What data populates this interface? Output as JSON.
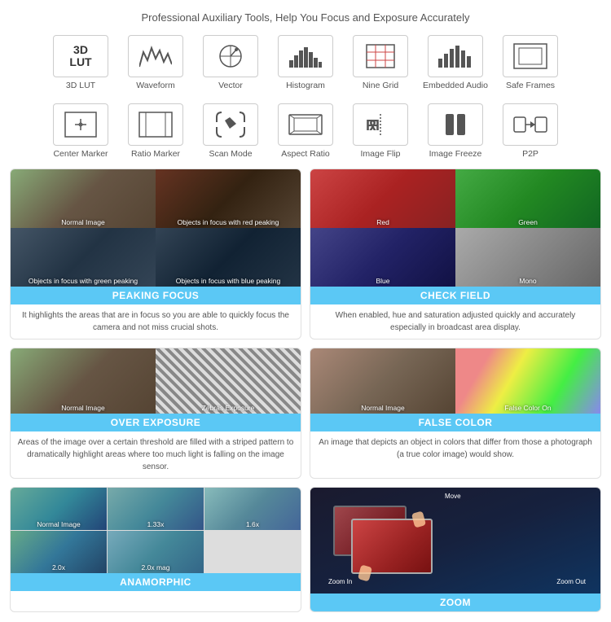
{
  "header": {
    "title": "Professional Auxiliary Tools, Help You Focus and Exposure Accurately"
  },
  "tools": {
    "row1": [
      {
        "id": "3d-lut",
        "label": "3D LUT",
        "icon_type": "lut"
      },
      {
        "id": "waveform",
        "label": "Waveform",
        "icon_type": "waveform"
      },
      {
        "id": "vector",
        "label": "Vector",
        "icon_type": "vector"
      },
      {
        "id": "histogram",
        "label": "Histogram",
        "icon_type": "histogram"
      },
      {
        "id": "nine-grid",
        "label": "Nine Grid",
        "icon_type": "ninegrid"
      },
      {
        "id": "embedded-audio",
        "label": "Embedded Audio",
        "icon_type": "audio"
      },
      {
        "id": "safe-frames",
        "label": "Safe Frames",
        "icon_type": "safeframes"
      }
    ],
    "row2": [
      {
        "id": "center-marker",
        "label": "Center Marker",
        "icon_type": "centermarker"
      },
      {
        "id": "ratio-marker",
        "label": "Ratio Marker",
        "icon_type": "ratiomarker"
      },
      {
        "id": "scan-mode",
        "label": "Scan Mode",
        "icon_type": "scanmode"
      },
      {
        "id": "aspect-ratio",
        "label": "Aspect Ratio",
        "icon_type": "aspectratio"
      },
      {
        "id": "image-flip",
        "label": "Image Flip",
        "icon_type": "imageflip"
      },
      {
        "id": "image-freeze",
        "label": "Image Freeze",
        "icon_type": "imagefreeze"
      },
      {
        "id": "p2p",
        "label": "P2P",
        "icon_type": "p2p"
      }
    ]
  },
  "features": [
    {
      "id": "peaking-focus",
      "title": "PEAKING FOCUS",
      "description": "It highlights the areas that are in focus so you are able to quickly focus the camera and not miss crucial shots.",
      "images": [
        {
          "label": "Normal Image",
          "class": "img-horse-normal"
        },
        {
          "label": "Objects in focus with red peaking",
          "class": "img-horse-red"
        },
        {
          "label": "Objects in focus with green peaking",
          "class": "img-horse-green-peak"
        },
        {
          "label": "Objects in focus with blue peaking",
          "class": "img-horse-blue-peak"
        }
      ]
    },
    {
      "id": "check-field",
      "title": "CHECK FIELD",
      "description": "When enabled, hue and saturation adjusted quickly and accurately especially in broadcast area display.",
      "images": [
        {
          "label": "Red",
          "class": "img-check-red"
        },
        {
          "label": "Green",
          "class": "img-check-green"
        },
        {
          "label": "Blue",
          "class": "img-check-blue"
        },
        {
          "label": "Mono",
          "class": "img-check-mono"
        }
      ]
    },
    {
      "id": "over-exposure",
      "title": "OVER EXPOSURE",
      "description": "Areas of the image over a certain threshold are filled with a striped pattern to dramatically highlight areas where too much light is falling on the image sensor.",
      "images": [
        {
          "label": "Normal Image",
          "class": "img-horse-normal"
        },
        {
          "label": "Zebras Exposure",
          "class": "img-horse-zebra"
        }
      ]
    },
    {
      "id": "false-color",
      "title": "FALSE COLOR",
      "description": "An image that depicts an object in colors that differ from those a photograph (a true color image) would show.",
      "images": [
        {
          "label": "Normal Image",
          "class": "img-false-normal"
        },
        {
          "label": "False Color On",
          "class": "img-false-on"
        }
      ]
    },
    {
      "id": "anamorphic",
      "title": "ANAMORPHIC",
      "description": "",
      "images": [
        {
          "label": "Normal Image",
          "class": "img-ana-1"
        },
        {
          "label": "1.33x",
          "class": "img-ana-2"
        },
        {
          "label": "1.6x",
          "class": "img-ana-3"
        },
        {
          "label": "2.0x",
          "class": "img-ana-4"
        },
        {
          "label": "2.0x mag",
          "class": "img-ana-5"
        }
      ]
    },
    {
      "id": "zoom",
      "title": "ZOOM",
      "description": "",
      "zoom_labels": {
        "move": "Move",
        "zoom_in": "Zoom In",
        "zoom_out": "Zoom Out"
      }
    }
  ]
}
